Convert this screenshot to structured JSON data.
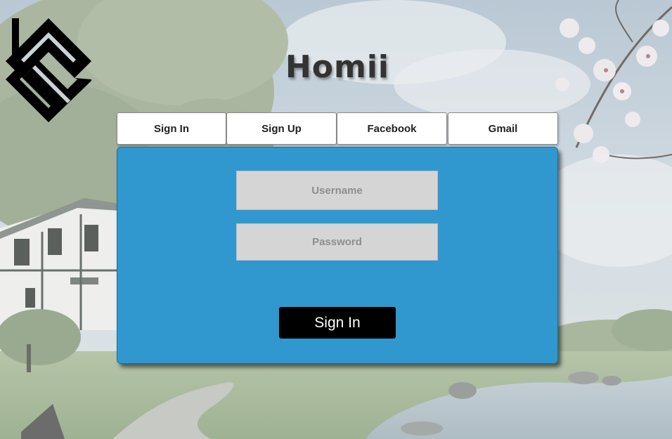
{
  "app": {
    "title": "Homii"
  },
  "tabs": [
    {
      "label": "Sign In"
    },
    {
      "label": "Sign Up"
    },
    {
      "label": "Facebook"
    },
    {
      "label": "Gmail"
    }
  ],
  "form": {
    "username": {
      "value": "",
      "placeholder": "Username"
    },
    "password": {
      "value": "",
      "placeholder": "Password"
    },
    "submit_label": "Sign In"
  },
  "colors": {
    "panel": "#3098cf",
    "button": "#000000",
    "field": "#d5d5d5"
  },
  "icons": {
    "logo": "house-s-logo-icon"
  }
}
